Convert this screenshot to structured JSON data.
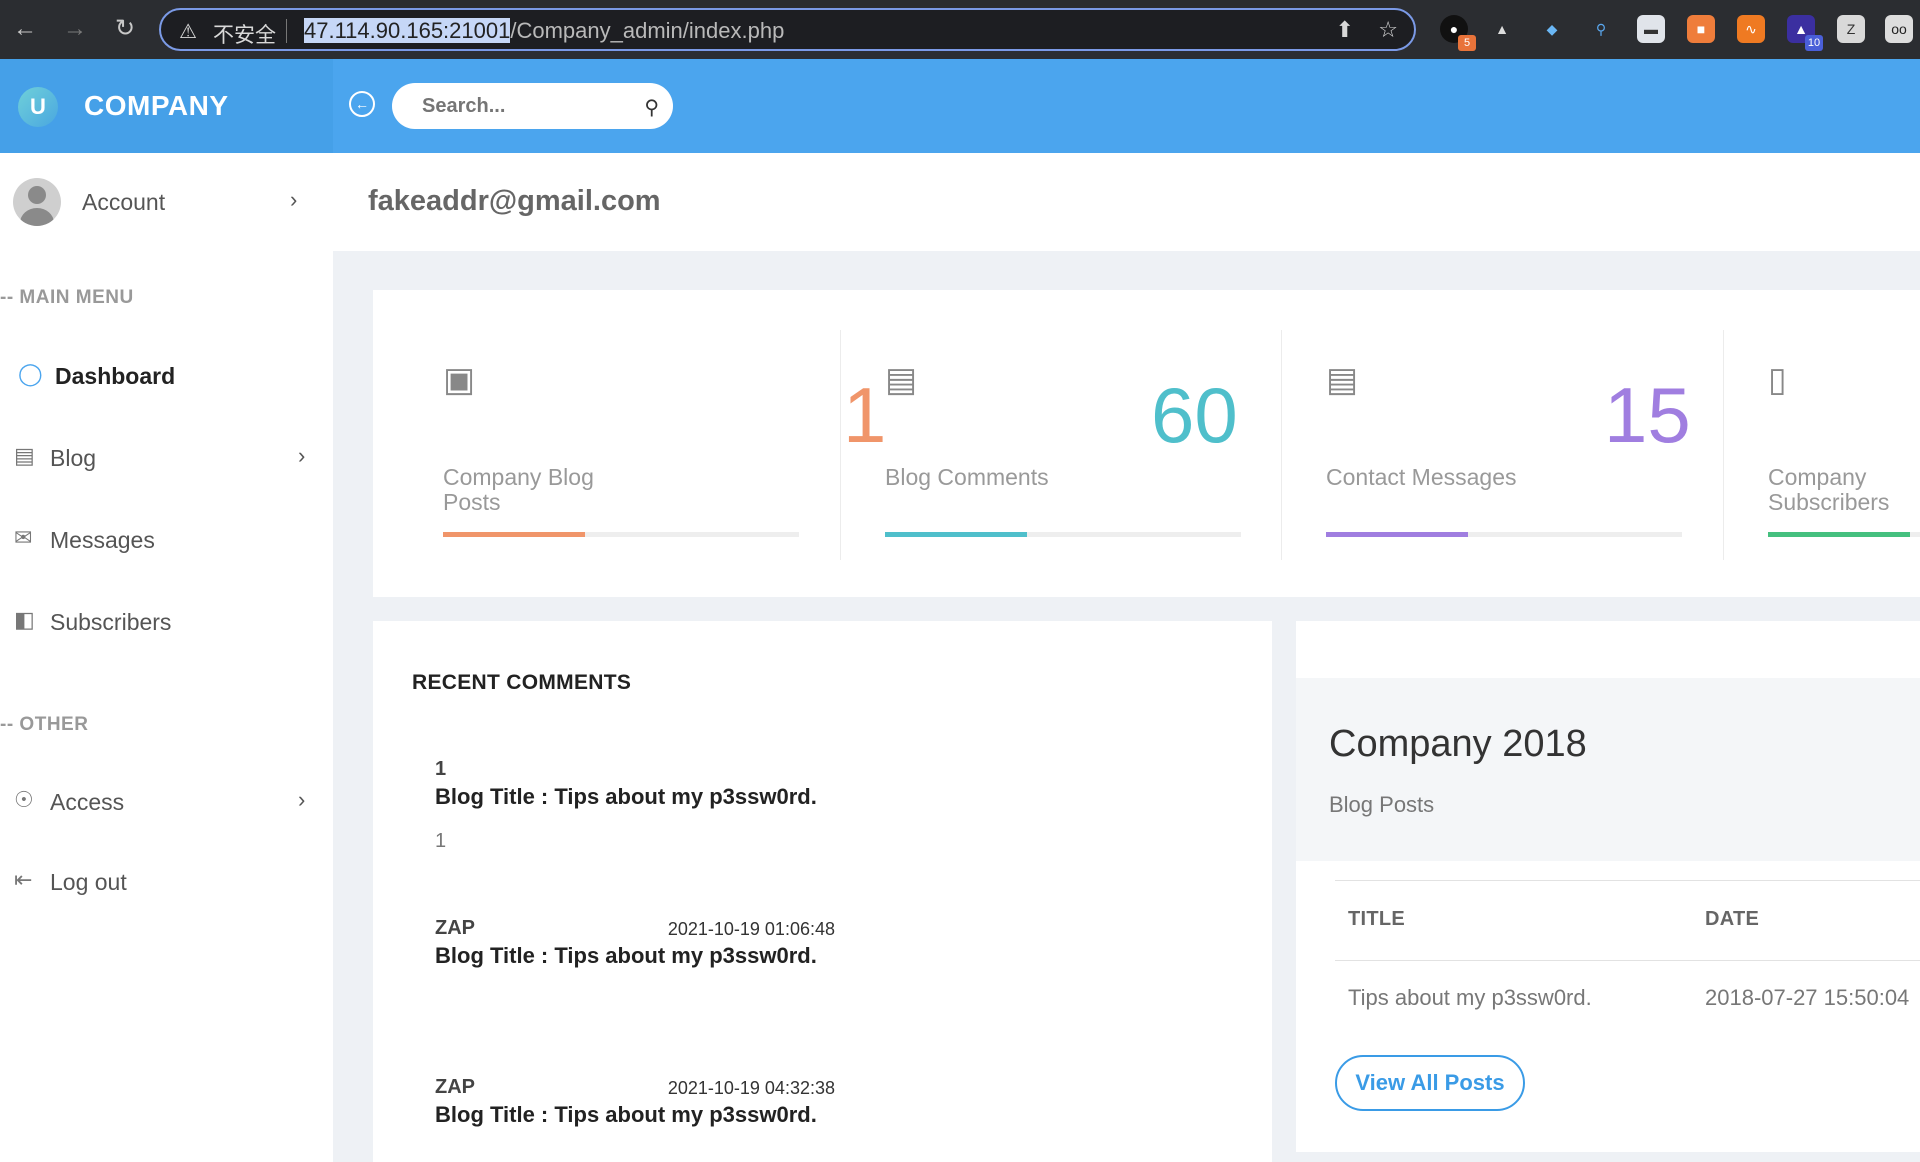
{
  "browser": {
    "insecure_label": "不安全",
    "url_host": "47.114.90.165:21001",
    "url_path": "/Company_admin/index.php",
    "extensions": [
      {
        "name": "ext-1",
        "badge": "5"
      },
      {
        "name": "ext-10",
        "badge": "10"
      }
    ]
  },
  "app": {
    "brand": "COMPANY",
    "logo_letter": "U",
    "search_placeholder": "Search..."
  },
  "sidebar": {
    "account_label": "Account",
    "main_menu_label": "-- MAIN MENU",
    "other_label": "-- OTHER",
    "items": {
      "dashboard": "Dashboard",
      "blog": "Blog",
      "messages": "Messages",
      "subscribers": "Subscribers",
      "access": "Access",
      "logout": "Log out"
    }
  },
  "main": {
    "email": "fakeaddr@gmail.com",
    "stats": [
      {
        "label": "Company Blog Posts",
        "value": "1",
        "color": "#f0956a",
        "fill": 0.4
      },
      {
        "label": "Blog Comments",
        "value": "60",
        "color": "#4fbfcb",
        "fill": 0.4
      },
      {
        "label": "Contact Messages",
        "value": "15",
        "color": "#a07ee0",
        "fill": 0.4
      },
      {
        "label": "Company Subscribers",
        "value": "",
        "color": "#45c07f",
        "fill": 0.4
      }
    ],
    "recent_comments": {
      "title": "RECENT COMMENTS",
      "items": [
        {
          "author": "1",
          "date": "",
          "title": "Blog Title : Tips about my p3ssw0rd.",
          "body": "1"
        },
        {
          "author": "ZAP",
          "date": "2021-10-19 01:06:48",
          "title": "Blog Title : Tips about my p3ssw0rd.",
          "body": ""
        },
        {
          "author": "ZAP",
          "date": "2021-10-19 04:32:38",
          "title": "Blog Title : Tips about my p3ssw0rd.",
          "body": ""
        }
      ]
    },
    "company": {
      "title": "Company 2018",
      "subtitle": "Blog Posts",
      "columns": [
        "TITLE",
        "DATE"
      ],
      "rows": [
        {
          "title": "Tips about my p3ssw0rd.",
          "date": "2018-07-27 15:50:04"
        }
      ],
      "view_all": "View All Posts"
    }
  }
}
